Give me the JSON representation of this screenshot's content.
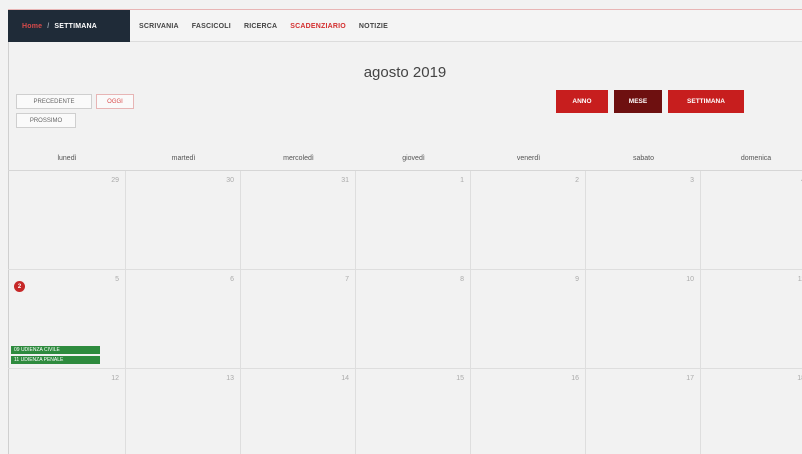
{
  "brand": {
    "home": "Home",
    "separator": "/",
    "section": "SETTIMANA"
  },
  "nav": [
    "SCRIVANIA",
    "FASCICOLI",
    "RICERCA",
    "SCADENZIARIO",
    "NOTIZIE"
  ],
  "nav_active_index": 3,
  "title": "agosto 2019",
  "buttons": {
    "prev": "PRECEDENTE",
    "today": "OGGI",
    "next": "PROSSIMO",
    "year": "ANNO",
    "month": "MESE",
    "week": "SETTIMANA"
  },
  "days": [
    "lunedì",
    "martedì",
    "mercoledì",
    "giovedì",
    "venerdì",
    "sabato",
    "domenica"
  ],
  "weeks": [
    [
      "29",
      "30",
      "31",
      "1",
      "2",
      "3",
      "4"
    ],
    [
      "5",
      "6",
      "7",
      "8",
      "9",
      "10",
      "11"
    ],
    [
      "12",
      "13",
      "14",
      "15",
      "16",
      "17",
      "18"
    ]
  ],
  "badge_count": "2",
  "events": [
    "09 UDIENZA CIVILE",
    "11 UDIENZA PENALE"
  ],
  "colors": {
    "accent": "#c71e1e",
    "active_view": "#6e1010",
    "navbar_brand": "#1f2b38",
    "event": "#2e8b3e"
  }
}
